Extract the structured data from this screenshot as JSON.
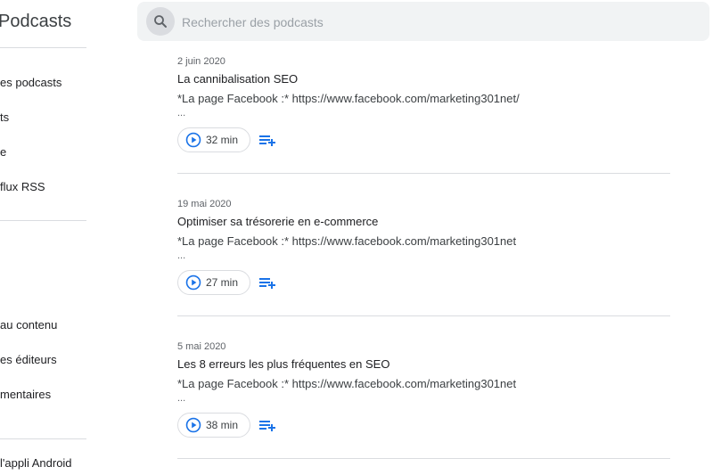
{
  "app": {
    "title": "Podcasts"
  },
  "sidebar": {
    "items": [
      {
        "label": "es podcasts"
      },
      {
        "label": "ts"
      },
      {
        "label": "e"
      },
      {
        "label": "flux RSS"
      },
      {
        "label": "au contenu"
      },
      {
        "label": "es éditeurs"
      },
      {
        "label": "mentaires"
      },
      {
        "label": "l'appli Android"
      }
    ]
  },
  "search": {
    "placeholder": "Rechercher des podcasts",
    "value": ""
  },
  "episodes": [
    {
      "date": "2 juin 2020",
      "title": "La cannibalisation SEO",
      "description": "*La page Facebook :* https://www.facebook.com/marketing301net/",
      "ellipsis": "...",
      "duration": "32 min"
    },
    {
      "date": "19 mai 2020",
      "title": "Optimiser sa trésorerie en e-commerce",
      "description": "*La page Facebook :* https://www.facebook.com/marketing301net",
      "ellipsis": "...",
      "duration": "27 min"
    },
    {
      "date": "5 mai 2020",
      "title": "Les 8 erreurs les plus fréquentes en SEO",
      "description": "*La page Facebook :* https://www.facebook.com/marketing301net",
      "ellipsis": "...",
      "duration": "38 min"
    }
  ],
  "colors": {
    "accent": "#1a73e8",
    "divider": "#dadce0",
    "search_bg": "#f1f3f4"
  },
  "icons": {
    "search": "search-icon",
    "play": "play-circle-icon",
    "queue": "playlist-add-icon"
  }
}
